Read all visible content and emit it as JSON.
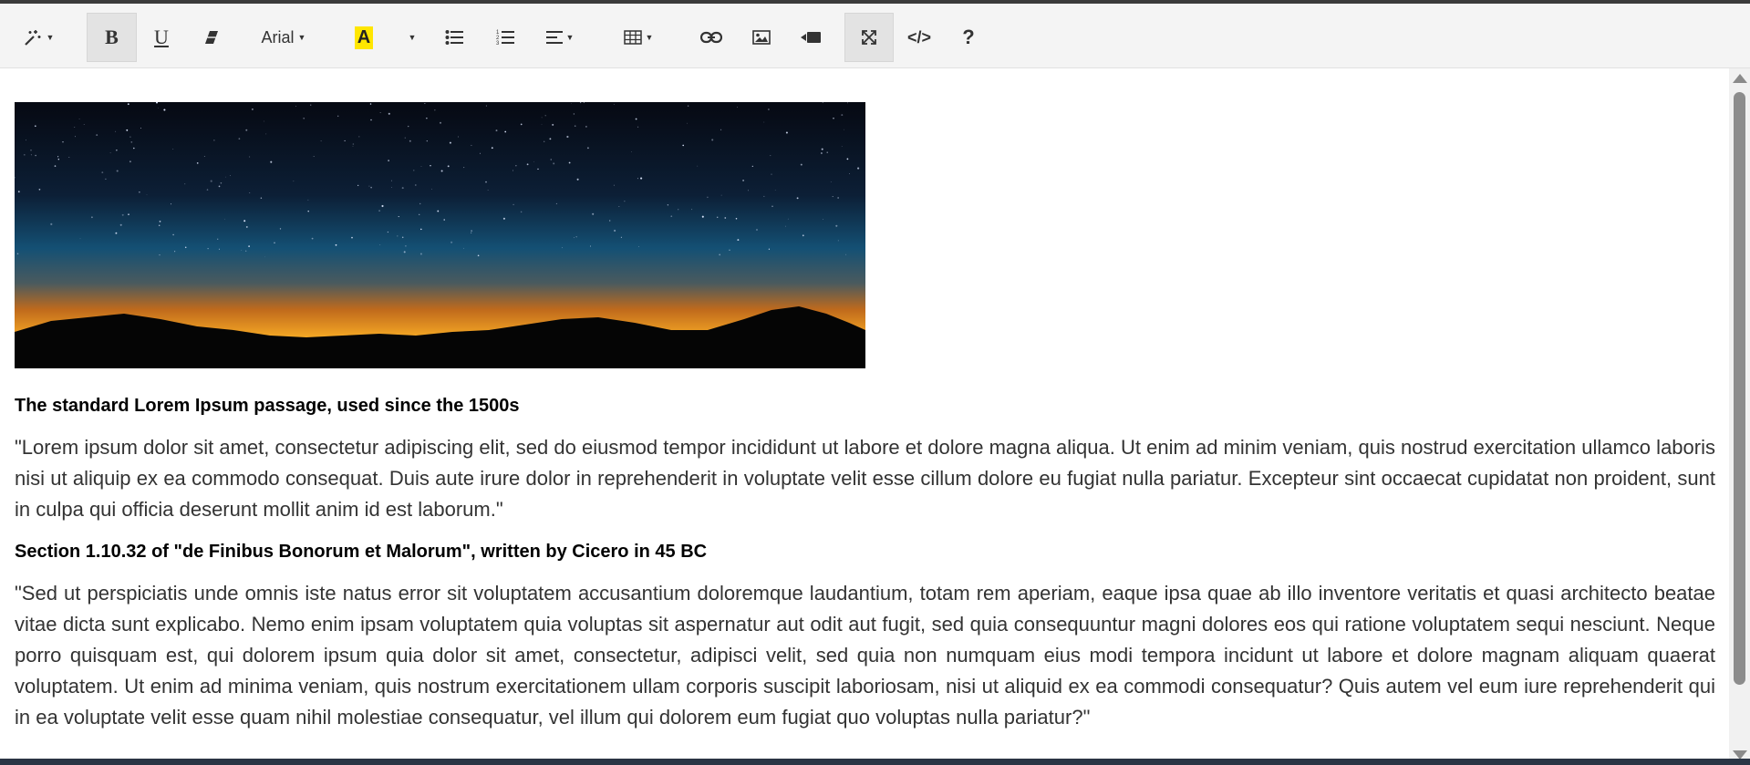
{
  "toolbar": {
    "font_name": "Arial",
    "code_view_label": "</>",
    "help_label": "?",
    "bold_label": "B",
    "underline_label": "U",
    "highlight_letter": "A",
    "highlight_color": "#ffe600",
    "buttons": [
      {
        "name": "magic-style-button",
        "icon": "magic-wand-icon"
      },
      {
        "name": "bold-button",
        "icon": "bold-icon",
        "active": true
      },
      {
        "name": "underline-button",
        "icon": "underline-icon"
      },
      {
        "name": "clear-format-button",
        "icon": "eraser-icon"
      },
      {
        "name": "font-family-dropdown",
        "icon": "chevron-down-icon"
      },
      {
        "name": "highlight-color-button",
        "icon": "text-highlight-icon"
      },
      {
        "name": "color-dropdown",
        "icon": "chevron-down-icon"
      },
      {
        "name": "bullet-list-button",
        "icon": "bullet-list-icon"
      },
      {
        "name": "numbered-list-button",
        "icon": "numbered-list-icon"
      },
      {
        "name": "align-dropdown",
        "icon": "align-left-icon"
      },
      {
        "name": "table-dropdown",
        "icon": "table-icon"
      },
      {
        "name": "link-button",
        "icon": "link-icon"
      },
      {
        "name": "image-button",
        "icon": "image-icon"
      },
      {
        "name": "video-button",
        "icon": "video-icon"
      },
      {
        "name": "fullscreen-button",
        "icon": "expand-icon",
        "active": true
      },
      {
        "name": "code-view-button",
        "icon": "code-icon"
      },
      {
        "name": "help-button",
        "icon": "help-icon"
      }
    ]
  },
  "document": {
    "image_description_icon": "night-sky-mountain-sunset-image",
    "heading1": "The standard Lorem Ipsum passage, used since the 1500s",
    "paragraph1": "\"Lorem ipsum dolor sit amet, consectetur adipiscing elit, sed do eiusmod tempor incididunt ut labore et dolore magna aliqua. Ut enim ad minim veniam, quis nostrud exercitation ullamco laboris nisi ut aliquip ex ea commodo consequat. Duis aute irure dolor in reprehenderit in voluptate velit esse cillum dolore eu fugiat nulla pariatur. Excepteur sint occaecat cupidatat non proident, sunt in culpa qui officia deserunt mollit anim id est laborum.\"",
    "heading2": "Section 1.10.32 of \"de Finibus Bonorum et Malorum\", written by Cicero in 45 BC",
    "paragraph2": "\"Sed ut perspiciatis unde omnis iste natus error sit voluptatem accusantium doloremque laudantium, totam rem aperiam, eaque ipsa quae ab illo inventore veritatis et quasi architecto beatae vitae dicta sunt explicabo. Nemo enim ipsam voluptatem quia voluptas sit aspernatur aut odit aut fugit, sed quia consequuntur magni dolores eos qui ratione voluptatem sequi nesciunt. Neque porro quisquam est, qui dolorem ipsum quia dolor sit amet, consectetur, adipisci velit, sed quia non numquam eius modi tempora incidunt ut labore et dolore magnam aliquam quaerat voluptatem. Ut enim ad minima veniam, quis nostrum exercitationem ullam corporis suscipit laboriosam, nisi ut aliquid ex ea commodi consequatur? Quis autem vel eum iure reprehenderit qui in ea voluptate velit esse quam nihil molestiae consequatur, vel illum qui dolorem eum fugiat quo voluptas nulla pariatur?\""
  },
  "colors": {
    "toolbar_bg": "#f4f4f4",
    "active_button_bg": "#e3e3e3",
    "text": "#333333",
    "heading": "#000000"
  }
}
